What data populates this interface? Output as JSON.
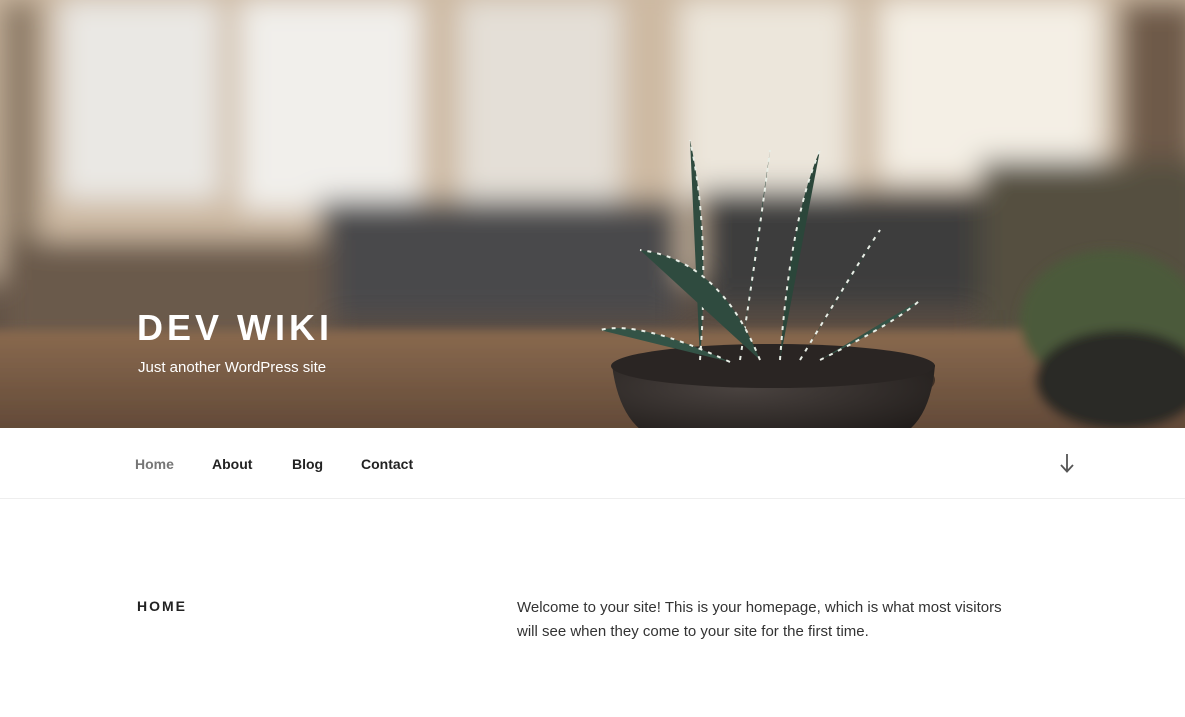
{
  "header": {
    "site_title": "DEV WIKI",
    "site_description": "Just another WordPress site"
  },
  "nav": {
    "items": [
      {
        "label": "Home",
        "current": true
      },
      {
        "label": "About",
        "current": false
      },
      {
        "label": "Blog",
        "current": false
      },
      {
        "label": "Contact",
        "current": false
      }
    ],
    "scroll_icon": "arrow-down-icon"
  },
  "main": {
    "page_title": "Home",
    "content": "Welcome to your site! This is your homepage, which is what most visitors will see when they come to your site for the first time."
  },
  "colors": {
    "nav_text": "#222222",
    "nav_current": "#767676",
    "body_text": "#333333"
  }
}
